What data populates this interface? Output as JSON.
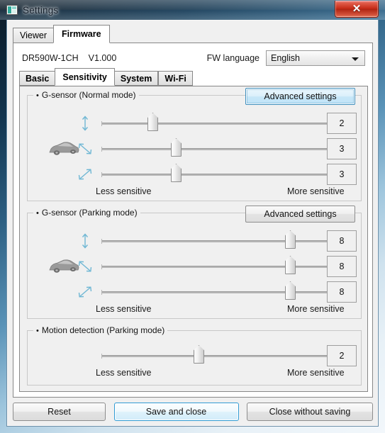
{
  "window": {
    "title": "Settings",
    "icon": "app-icon",
    "close_label": "✕"
  },
  "outer_tabs": [
    {
      "label": "Viewer",
      "active": false
    },
    {
      "label": "Firmware",
      "active": true
    }
  ],
  "device": {
    "model": "DR590W-1CH",
    "version": "V1.000",
    "fw_language_label": "FW language",
    "fw_language_value": "English"
  },
  "inner_tabs": [
    {
      "label": "Basic",
      "active": false
    },
    {
      "label": "Sensitivity",
      "active": true
    },
    {
      "label": "System",
      "active": false
    },
    {
      "label": "Wi-Fi",
      "active": false
    }
  ],
  "groups": [
    {
      "title": "G-sensor (Normal mode)",
      "bullet": "•",
      "advanced_label": "Advanced settings",
      "advanced_focused": true,
      "less_label": "Less sensitive",
      "more_label": "More sensitive",
      "sliders": [
        {
          "axis": "vertical",
          "value": "2",
          "percent": 21,
          "has_car": false
        },
        {
          "axis": "diagonal-down",
          "value": "3",
          "percent": 31,
          "has_car": true
        },
        {
          "axis": "diagonal-up",
          "value": "3",
          "percent": 31,
          "has_car": false
        }
      ]
    },
    {
      "title": "G-sensor (Parking mode)",
      "bullet": "•",
      "advanced_label": "Advanced settings",
      "advanced_focused": false,
      "less_label": "Less sensitive",
      "more_label": "More sensitive",
      "sliders": [
        {
          "axis": "vertical",
          "value": "8",
          "percent": 78,
          "has_car": false
        },
        {
          "axis": "diagonal-down",
          "value": "8",
          "percent": 78,
          "has_car": true
        },
        {
          "axis": "diagonal-up",
          "value": "8",
          "percent": 78,
          "has_car": false
        }
      ]
    },
    {
      "title": "Motion detection (Parking mode)",
      "bullet": "•",
      "advanced_label": null,
      "advanced_focused": false,
      "less_label": "Less sensitive",
      "more_label": "More sensitive",
      "sliders": [
        {
          "axis": "none",
          "value": "2",
          "percent": 40,
          "has_car": false
        }
      ]
    }
  ],
  "footer": {
    "reset_label": "Reset",
    "save_label": "Save and close",
    "close_label": "Close without saving"
  },
  "colors": {
    "accent": "#3c8dbc",
    "close_button": "#c62b18",
    "panel_bg": "#f0f0f0",
    "arrow_icon": "#6fb7d4"
  }
}
